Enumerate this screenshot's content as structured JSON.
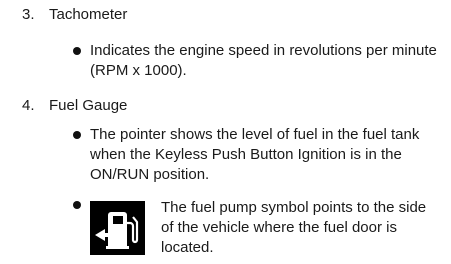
{
  "items": [
    {
      "number": "3.",
      "heading": "Tachometer",
      "bullets": [
        "Indicates the engine speed in revolutions per minute (RPM x 1000)."
      ]
    },
    {
      "number": "4.",
      "heading": "Fuel Gauge",
      "bullets": [
        "The pointer shows the level of fuel in the fuel tank when the Keyless Push Button Ignition is in the ON/RUN position.",
        "The fuel pump symbol points to the side of the vehicle where the fuel door is located."
      ],
      "icon": "fuel-pump-icon"
    }
  ]
}
